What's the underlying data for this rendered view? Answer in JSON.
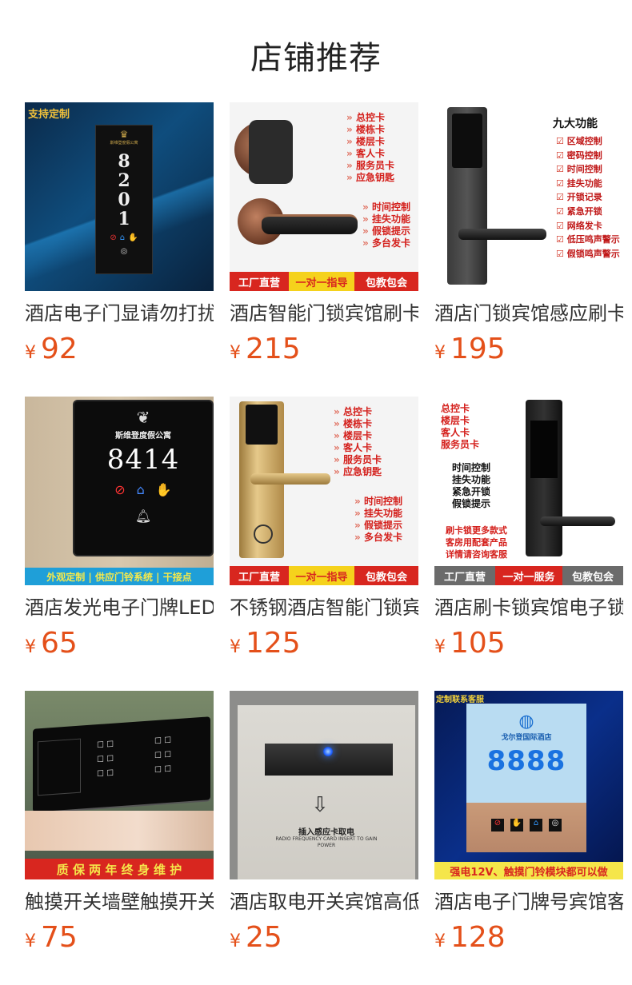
{
  "page_title": "店铺推荐",
  "currency": "¥",
  "products": [
    {
      "name": "酒店电子门显请勿打扰",
      "price": "92",
      "img": {
        "badge": "支持定制",
        "door_number": "8201",
        "hotel_name": "斯维登度假公寓"
      }
    },
    {
      "name": "酒店智能门锁宾馆刷卡",
      "price": "215",
      "img": {
        "cards": [
          "总控卡",
          "楼栋卡",
          "楼层卡",
          "客人卡",
          "服务员卡",
          "应急钥匙"
        ],
        "features": [
          "时间控制",
          "挂失功能",
          "假锁提示",
          "多台发卡"
        ],
        "banner": [
          "工厂直营",
          "一对一指导",
          "包教包会"
        ]
      }
    },
    {
      "name": "酒店门锁宾馆感应刷卡",
      "price": "195",
      "img": {
        "heading": "九大功能",
        "functions": [
          "区域控制",
          "密码控制",
          "时间控制",
          "挂失功能",
          "开锁记录",
          "紧急开锁",
          "网络发卡",
          "低压鸣声警示",
          "假锁鸣声警示"
        ]
      }
    },
    {
      "name": "酒店发光电子门牌LED",
      "price": "65",
      "img": {
        "hotel_name": "斯维登度假公寓",
        "door_number": "8414",
        "banner": "外观定制 | 供应门铃系统 | 干接点"
      }
    },
    {
      "name": "不锈钢酒店智能门锁宾馆",
      "price": "125",
      "img": {
        "cards": [
          "总控卡",
          "楼栋卡",
          "楼层卡",
          "客人卡",
          "服务员卡",
          "应急钥匙"
        ],
        "features": [
          "时间控制",
          "挂失功能",
          "假锁提示",
          "多台发卡"
        ],
        "banner": [
          "工厂直营",
          "一对一指导",
          "包教包会"
        ]
      }
    },
    {
      "name": "酒店刷卡锁宾馆电子锁",
      "price": "105",
      "img": {
        "cards": [
          "总控卡",
          "楼层卡",
          "客人卡",
          "服务员卡"
        ],
        "features": [
          "时间控制",
          "挂失功能",
          "紧急开锁",
          "假锁提示"
        ],
        "notes": [
          "刷卡锁更多款式",
          "客房用配套产品",
          "详情请咨询客服"
        ],
        "banner": [
          "工厂直营",
          "一对一服务",
          "包教包会"
        ]
      }
    },
    {
      "name": "触摸开关墙壁触摸开关",
      "price": "75",
      "img": {
        "banner": "质 保 两 年 终 身 维 护"
      }
    },
    {
      "name": "酒店取电开关宾馆高低频",
      "price": "25",
      "img": {
        "slot_text": "插入感应卡取电",
        "slot_text_en": "RADIO FREQUENCY CARD INSERT TO GAIN POWER"
      }
    },
    {
      "name": "酒店电子门牌号宾馆客房",
      "price": "128",
      "img": {
        "badge": "定制联系客服",
        "hotel_name": "戈尔登国际酒店",
        "door_number": "8888",
        "banner": "强电12V、触摸门铃模块都可以做"
      }
    }
  ],
  "colors": {
    "price": "#e4501a",
    "banner_red": "#d8261f",
    "feature_red": "#d4201c"
  }
}
